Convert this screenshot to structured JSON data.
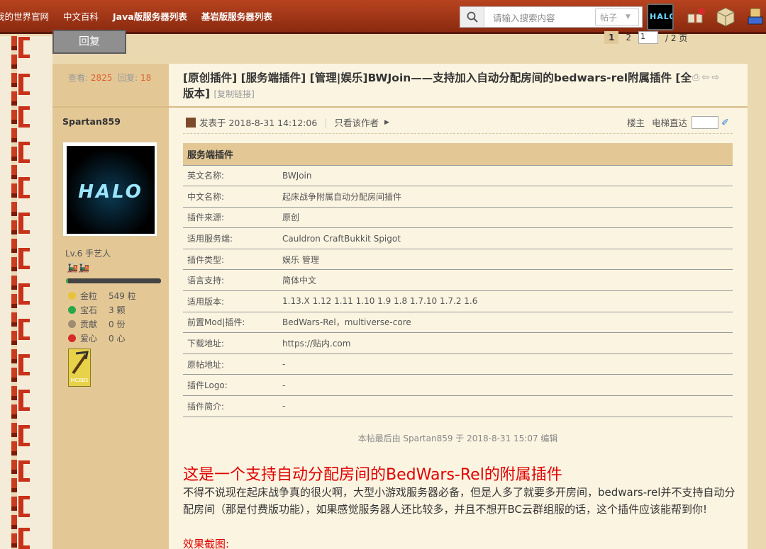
{
  "nav": {
    "items": [
      "我的世界官网",
      "中文百科",
      "Java版服务器列表",
      "基岩版服务器列表"
    ]
  },
  "search": {
    "placeholder": "请输入搜索内容",
    "scope": "帖子"
  },
  "reply_button": "回复",
  "pager": {
    "current": "1",
    "next": "2",
    "input": "1",
    "total": "/ 2 页"
  },
  "stats": {
    "views_label": "查看:",
    "views": "2825",
    "replies_label": "回复:",
    "replies": "18"
  },
  "post": {
    "title": "[原创插件] [服务端插件] [管理|娱乐]BWJoin——支持加入自动分配房间的bedwars-rel附属插件 [全版本]",
    "copy_link": "[复制链接]",
    "posted": "发表于 2018-8-31 14:12:06",
    "only_author": "只看该作者",
    "floor": "楼主",
    "elevator": "电梯直达",
    "edit_note": "本帖最后由 Spartan859 于 2018-8-31 15:07 编辑",
    "heading": "这是一个支持自动分配房间的BedWars-Rel的附属插件",
    "body": "不得不说现在起床战争真的很火啊，大型小游戏服务器必备，但是人多了就要多开房间，bedwars-rel并不支持自动分配房间（那是付费版功能），如果感觉服务器人还比较多，并且不想开BC云群组服的话，这个插件应该能帮到你!",
    "screenshots_label": "效果截图:"
  },
  "user": {
    "name": "Spartan859",
    "avatar_text": "HALO",
    "level": "Lv.6 手艺人",
    "xp_fraction": 0.02,
    "gold_label": "金粒",
    "gold": "549 粒",
    "gem_label": "宝石",
    "gem": "3 颗",
    "contrib_label": "贡献",
    "contrib": "0 份",
    "love_label": "爱心",
    "love": "0 心",
    "badge_text": "MCBBS"
  },
  "plugin_table": {
    "header": "服务端插件",
    "rows": [
      [
        "英文名称:",
        "BWJoin"
      ],
      [
        "中文名称:",
        "起床战争附属自动分配房间插件"
      ],
      [
        "插件来源:",
        "原创"
      ],
      [
        "适用服务端:",
        "Cauldron CraftBukkit Spigot"
      ],
      [
        "插件类型:",
        "娱乐 管理"
      ],
      [
        "语言支持:",
        "简体中文"
      ],
      [
        "适用版本:",
        "1.13.X 1.12 1.11 1.10 1.9 1.8 1.7.10 1.7.2 1.6"
      ],
      [
        "前置Mod|插件:",
        "BedWars-Rel，multiverse-core"
      ],
      [
        "下载地址:",
        "https://贴内.com"
      ],
      [
        "原帖地址:",
        "-"
      ],
      [
        "插件Logo:",
        "-"
      ],
      [
        "插件简介:",
        "-"
      ]
    ]
  },
  "colors": {
    "topbar": "#a0361a",
    "sidebar": "#e3c896",
    "content_bg": "#fbf4e1",
    "red_heading": "#e00000",
    "stat_highlight": "#e0612e"
  },
  "icons": [
    "search-icon",
    "gift-icon",
    "block-icon",
    "user-icon",
    "print-icon",
    "prev-icon",
    "next-icon",
    "pen-icon"
  ]
}
